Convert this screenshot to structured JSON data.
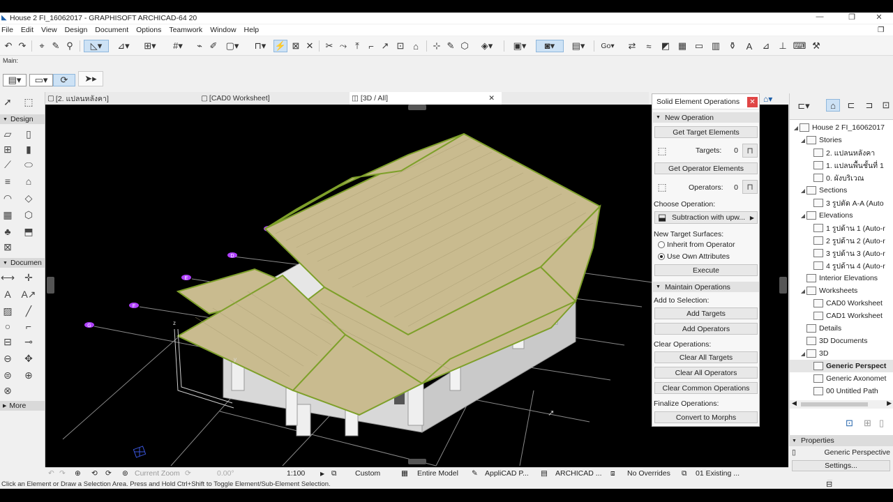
{
  "window": {
    "title": "House 2 FI_16062017 - GRAPHISOFT ARCHICAD-64 20"
  },
  "menu": [
    "File",
    "Edit",
    "View",
    "Design",
    "Document",
    "Options",
    "Teamwork",
    "Window",
    "Help"
  ],
  "toolbar": {
    "main_label": "Main:",
    "go_label": "Go"
  },
  "tabs": [
    {
      "label": "[2. แปลนหลังคา]"
    },
    {
      "label": "[CAD0 Worksheet]"
    },
    {
      "label": "[3D / All]",
      "active": true
    }
  ],
  "left_panel": {
    "design_label": "Design",
    "document_label": "Documen",
    "more_label": "More"
  },
  "viewport": {
    "grid_labels": [
      "C",
      "D",
      "E",
      "F",
      "G"
    ],
    "axis_labels": [
      "x",
      "y",
      "z"
    ]
  },
  "solid_ops": {
    "title": "Solid Element Operations",
    "new_operation": "New Operation",
    "get_target": "Get Target Elements",
    "targets_label": "Targets:",
    "targets_count": "0",
    "get_operator": "Get Operator Elements",
    "operators_label": "Operators:",
    "operators_count": "0",
    "choose_operation": "Choose Operation:",
    "operation_value": "Subtraction with upw...",
    "new_target_surfaces": "New Target Surfaces:",
    "inherit": "Inherit from Operator",
    "use_own": "Use Own Attributes",
    "execute": "Execute",
    "maintain": "Maintain Operations",
    "add_to_selection": "Add to Selection:",
    "add_targets": "Add Targets",
    "add_operators": "Add Operators",
    "clear_operations": "Clear Operations:",
    "clear_targets": "Clear All Targets",
    "clear_operators": "Clear All Operators",
    "clear_common": "Clear Common Operations",
    "finalize": "Finalize Operations:",
    "convert": "Convert to Morphs"
  },
  "navigator": {
    "items": [
      {
        "label": "House 2 FI_16062017",
        "level": 0,
        "arrow": "◢"
      },
      {
        "label": "Stories",
        "level": 1,
        "arrow": "◢"
      },
      {
        "label": "2. แปลนหลังคา",
        "level": 2
      },
      {
        "label": "1. แปลนพื้นชั้นที่ 1",
        "level": 2
      },
      {
        "label": "0. ผังบริเวณ",
        "level": 2
      },
      {
        "label": "Sections",
        "level": 1,
        "arrow": "◢"
      },
      {
        "label": "3 รูปตัด A-A (Auto",
        "level": 2
      },
      {
        "label": "Elevations",
        "level": 1,
        "arrow": "◢"
      },
      {
        "label": "1 รูปด้าน 1 (Auto-r",
        "level": 2
      },
      {
        "label": "2 รูปด้าน 2 (Auto-r",
        "level": 2
      },
      {
        "label": "3 รูปด้าน 3 (Auto-r",
        "level": 2
      },
      {
        "label": "4 รูปด้าน 4 (Auto-r",
        "level": 2
      },
      {
        "label": "Interior Elevations",
        "level": 1
      },
      {
        "label": "Worksheets",
        "level": 1,
        "arrow": "◢"
      },
      {
        "label": "CAD0 Worksheet",
        "level": 2
      },
      {
        "label": "CAD1 Worksheet",
        "level": 2
      },
      {
        "label": "Details",
        "level": 1
      },
      {
        "label": "3D Documents",
        "level": 1
      },
      {
        "label": "3D",
        "level": 1,
        "arrow": "◢"
      },
      {
        "label": "Generic Perspect",
        "level": 2,
        "selected": true
      },
      {
        "label": "Generic Axonomet",
        "level": 2
      },
      {
        "label": "00 Untitled Path",
        "level": 2
      }
    ]
  },
  "properties": {
    "label": "Properties",
    "value": "Generic Perspective",
    "settings": "Settings..."
  },
  "statusbar": {
    "zoom_label": "Current Zoom",
    "angle": "0.00°",
    "scale": "1:100",
    "layer": "Custom",
    "model": "Entire Model",
    "pen": "AppliCAD P...",
    "mvo": "ARCHICAD ...",
    "overrides": "No Overrides",
    "renovation": "01 Existing ..."
  },
  "hint": "Click an Element or Draw a Selection Area. Press and Hold Ctrl+Shift to Toggle Element/Sub-Element Selection.",
  "colors": {
    "roof": "#c9bb8f",
    "roof_edge": "#7ea02a",
    "wall": "#e0e0e0",
    "grid": "#8a8a8a",
    "grid_label": "#b040ff"
  }
}
